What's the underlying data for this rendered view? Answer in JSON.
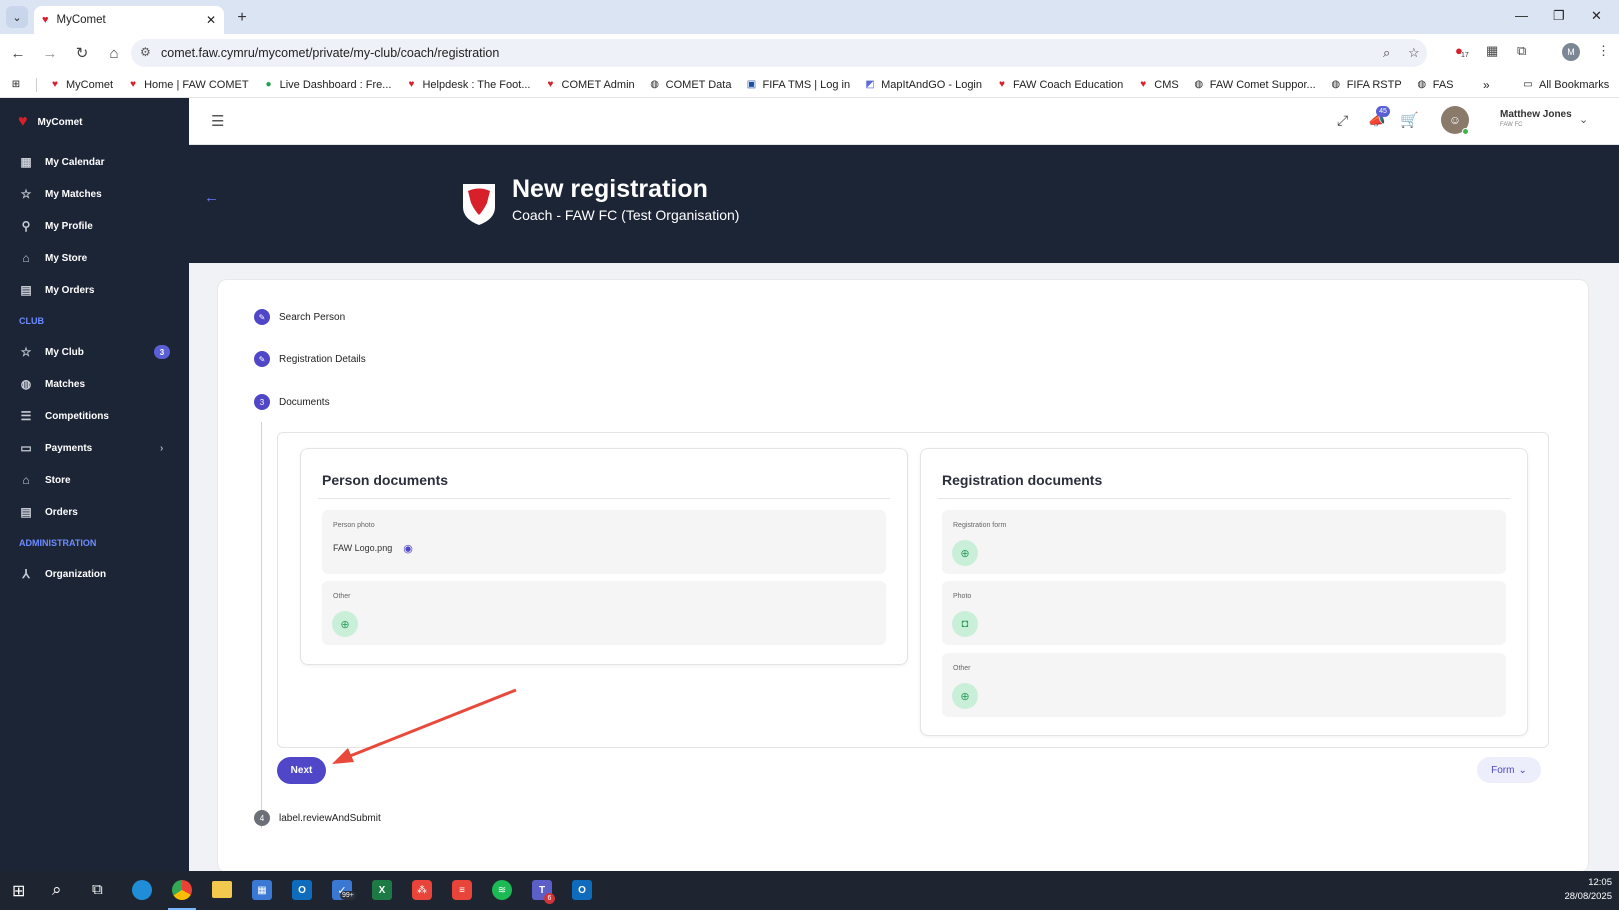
{
  "browser": {
    "tab_title": "MyComet",
    "url": "comet.faw.cymru/mycomet/private/my-club/coach/registration",
    "profile_initial": "M",
    "ext_badge": "17",
    "all_bookmarks": "All Bookmarks",
    "bookmarks": [
      "MyComet",
      "Home | FAW COMET",
      "Live Dashboard : Fre...",
      "Helpdesk : The Foot...",
      "COMET Admin",
      "COMET Data",
      "FIFA TMS | Log in",
      "MapItAndGO - Login",
      "FAW Coach Education",
      "CMS",
      "FAW Comet Suppor...",
      "FIFA RSTP",
      "FAS"
    ]
  },
  "sidebar": {
    "brand": "MyComet",
    "items": [
      {
        "label": "My Calendar",
        "icon": "calendar-icon"
      },
      {
        "label": "My Matches",
        "icon": "star-icon"
      },
      {
        "label": "My Profile",
        "icon": "person-icon"
      },
      {
        "label": "My Store",
        "icon": "store-icon"
      },
      {
        "label": "My Orders",
        "icon": "orders-icon"
      }
    ],
    "club_section": "CLUB",
    "club_items": [
      {
        "label": "My Club",
        "icon": "star-icon",
        "badge": "3"
      },
      {
        "label": "Matches",
        "icon": "football-icon"
      },
      {
        "label": "Competitions",
        "icon": "list-icon"
      },
      {
        "label": "Payments",
        "icon": "card-icon"
      },
      {
        "label": "Store",
        "icon": "store-icon"
      },
      {
        "label": "Orders",
        "icon": "orders-icon"
      }
    ],
    "admin_section": "ADMINISTRATION",
    "admin_items": [
      {
        "label": "Organization",
        "icon": "organization-icon"
      }
    ]
  },
  "topbar": {
    "notification_count": "45",
    "user_name": "Matthew Jones",
    "user_org": "FAW FC"
  },
  "hero": {
    "title": "New registration",
    "subtitle": "Coach - FAW FC (Test Organisation)"
  },
  "steps": {
    "s1": "Search Person",
    "s2": "Registration Details",
    "s3_num": "3",
    "s3": "Documents",
    "s4_num": "4",
    "s4": "label.reviewAndSubmit"
  },
  "person_docs": {
    "title": "Person documents",
    "photo_label": "Person photo",
    "photo_file": "FAW Logo.png",
    "other_label": "Other"
  },
  "registration_docs": {
    "title": "Registration documents",
    "form_label": "Registration form",
    "photo_label": "Photo",
    "other_label": "Other"
  },
  "actions": {
    "next": "Next",
    "form": "Form"
  },
  "taskbar": {
    "time": "12:05",
    "date": "28/08/2025",
    "badge_99": "99+",
    "badge_teams": "6"
  },
  "colors": {
    "sidebar_bg": "#1c2536",
    "accent": "#4f46c8",
    "upload_green": "#c9efd8"
  }
}
